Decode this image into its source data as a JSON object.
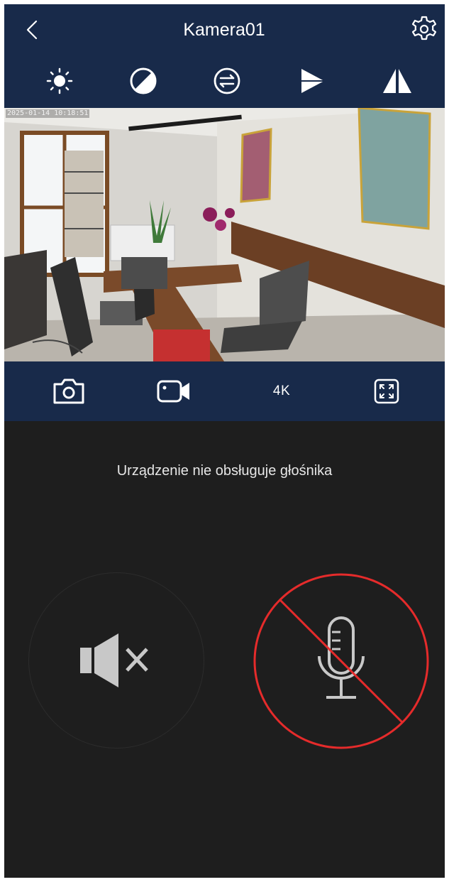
{
  "header": {
    "title": "Kamera01",
    "back_icon": "chevron-left-icon",
    "settings_icon": "gear-icon"
  },
  "toolbar": {
    "items": [
      {
        "name": "brightness",
        "icon": "sun-icon"
      },
      {
        "name": "contrast",
        "icon": "contrast-icon"
      },
      {
        "name": "swap",
        "icon": "swap-arrows-icon"
      },
      {
        "name": "flip",
        "icon": "triangle-flip-icon"
      },
      {
        "name": "mirror",
        "icon": "mirror-icon"
      }
    ]
  },
  "video": {
    "timestamp": "2025-01-14 10:18:51"
  },
  "controls": {
    "snapshot_icon": "camera-icon",
    "record_icon": "video-record-icon",
    "quality_label": "4K",
    "fullscreen_icon": "fullscreen-icon"
  },
  "audio": {
    "notice": "Urządzenie nie obsługuje głośnika",
    "speaker_icon": "speaker-muted-icon",
    "mic_icon": "microphone-disabled-icon"
  },
  "colors": {
    "navy": "#182a4a",
    "background": "#1e1e1e",
    "disabled_red": "#e52b2b",
    "icon_gray": "#c8c8c8"
  }
}
